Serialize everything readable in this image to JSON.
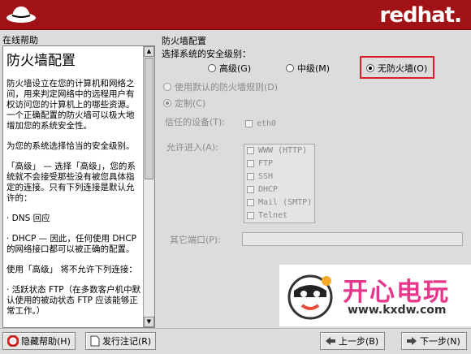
{
  "header": {
    "brand": "redhat",
    "brand_dot": "."
  },
  "help": {
    "panel_label": "在线帮助",
    "title": "防火墙配置",
    "paragraphs": [
      "防火墙设立在您的计算机和网络之间，用来判定网络中的远程用户有权访问您的计算机上的哪些资源。一个正确配置的防火墙可以极大地增加您的系统安全性。",
      "为您的系统选择恰当的安全级别。",
      "「高级」 — 选择「高级」，您的系统就不会接受那些没有被您具体指定的连接。只有下列连接是默认允许的：",
      "· DNS 回应",
      "· DHCP — 因此，任何使用 DHCP 的网络接口都可以被正确的配置。",
      "使用「高级」 将不允许下列连接：",
      "· 活跃状态 FTP（在多数客户机中默认使用的被动状态 FTP 应该能够正常工作。）"
    ]
  },
  "config": {
    "section_label": "防火墙配置",
    "security_level_label": "选择系统的安全级别：",
    "levels": [
      {
        "label": "高级(G)",
        "selected": false
      },
      {
        "label": "中级(M)",
        "selected": false
      },
      {
        "label": "无防火墙(O)",
        "selected": true
      }
    ],
    "use_default_label": "使用默认的防火墙规则(D)",
    "custom_label": "定制(C)",
    "trusted_devices_label": "信任的设备(T):",
    "trusted_devices": [
      "eth0"
    ],
    "allow_incoming_label": "允许进入(A):",
    "allow_incoming": [
      "WWW (HTTP)",
      "FTP",
      "SSH",
      "DHCP",
      "Mail (SMTP)",
      "Telnet"
    ],
    "other_ports_label": "其它端口(P):",
    "other_ports_value": ""
  },
  "buttons": {
    "hide_help": "隐藏帮助(H)",
    "release_notes": "发行注记(R)",
    "back": "上一步(B)",
    "next": "下一步(N)"
  },
  "watermark": {
    "title": "开心电玩",
    "url": "www.kxdw.com"
  },
  "colors": {
    "header_bg": "#a01216",
    "highlight": "#d8202a",
    "watermark_pink": "#e6378d"
  }
}
